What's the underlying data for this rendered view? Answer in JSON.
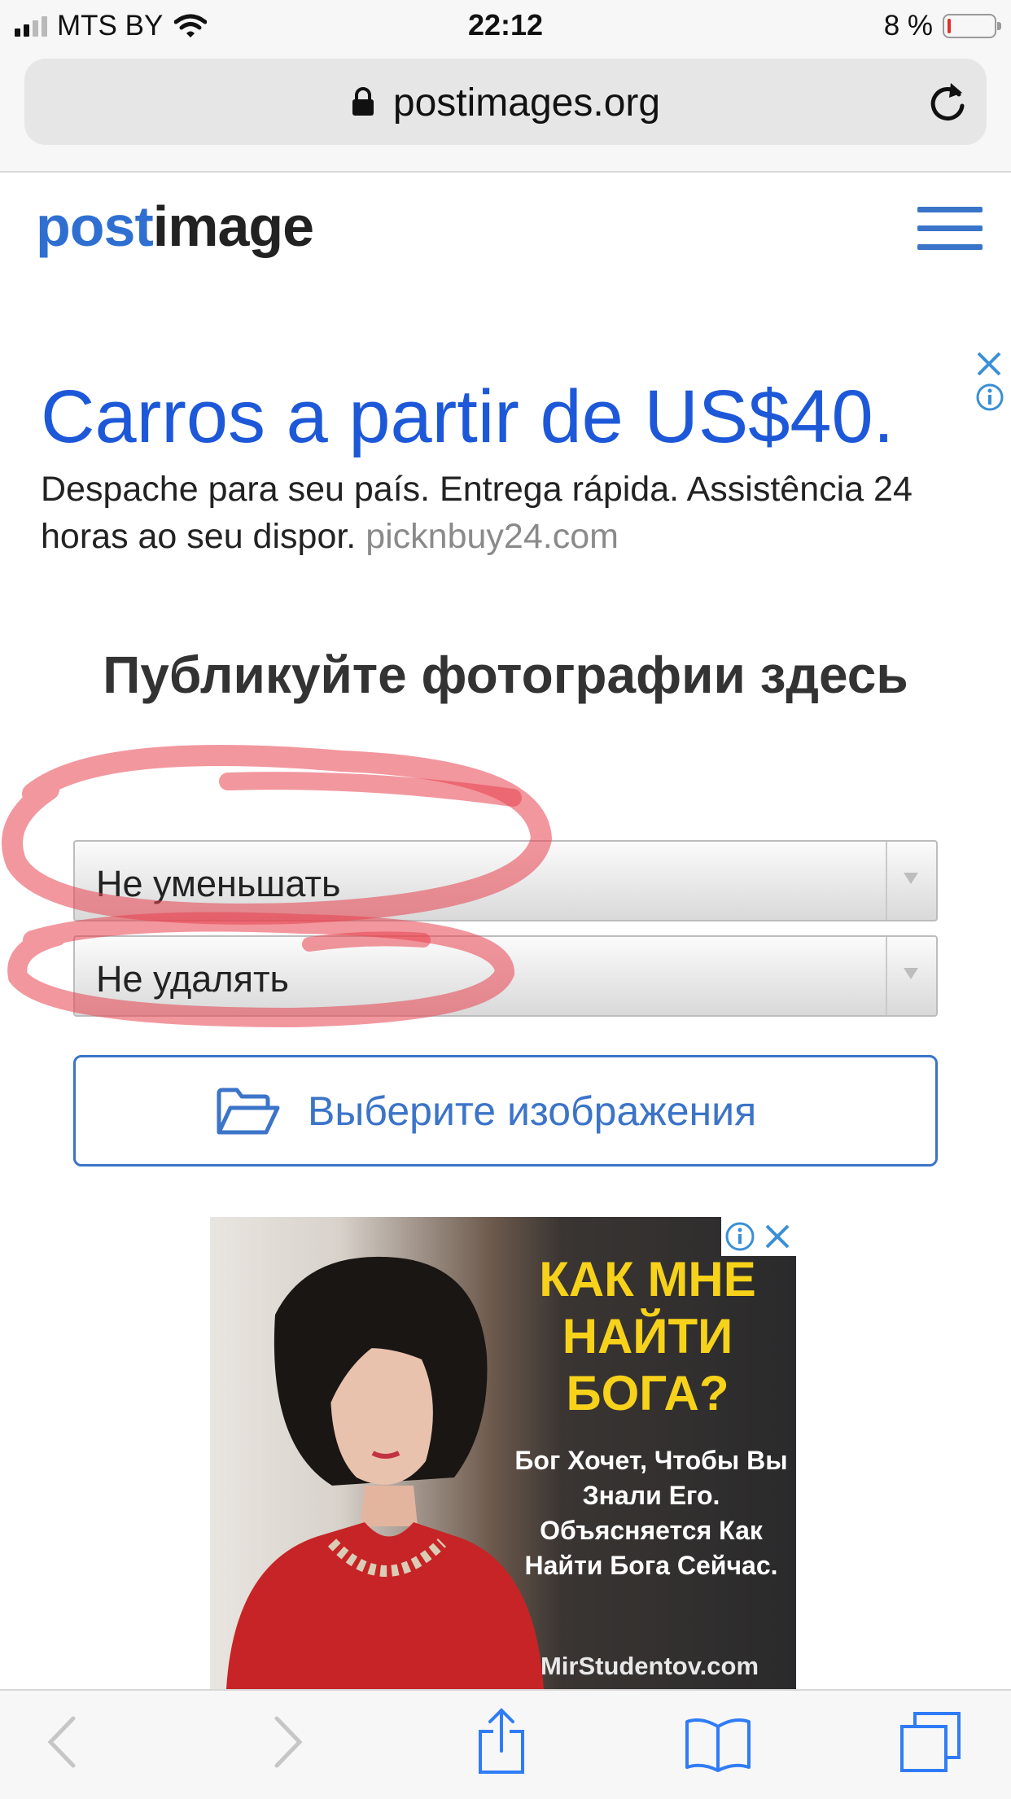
{
  "status": {
    "carrier": "MTS BY",
    "time": "22:12",
    "battery": "8 %",
    "battery_level": 0.08,
    "signal_bars": 2
  },
  "browser": {
    "url": "postimages.org",
    "icons": [
      "lock-icon",
      "reload-icon"
    ]
  },
  "site": {
    "logo_part1": "post",
    "logo_part2": "image",
    "menu_icon": "hamburger-icon"
  },
  "ad_top": {
    "title": "Carros a partir de US$40.",
    "description": "Despache para seu país. Entrega rápida. Assistência 24 horas ao seu dispor.",
    "site": "picknbuy24.com"
  },
  "main": {
    "heading": "Публикуйте фотографии здесь",
    "resize_select": "Не уменьшать",
    "expire_select": "Не удалять",
    "choose_button": "Выберите изображения"
  },
  "ad_image": {
    "headline": "КАК МНЕ НАЙТИ БОГА?",
    "body": "Бог Хочет, Чтобы Вы Знали Его. Объясняется Как Найти Бога Сейчас.",
    "domain": "MirStudentov.com"
  },
  "toolbar": {
    "icons": [
      "back-icon",
      "forward-icon",
      "share-icon",
      "bookmarks-icon",
      "tabs-icon"
    ]
  },
  "colors": {
    "brand_blue": "#2f6fd1",
    "ad_blue": "#1d58d9",
    "button_blue": "#3c74c8",
    "annotation_red": "#e8414f",
    "ad_yellow": "#f7d21a"
  }
}
